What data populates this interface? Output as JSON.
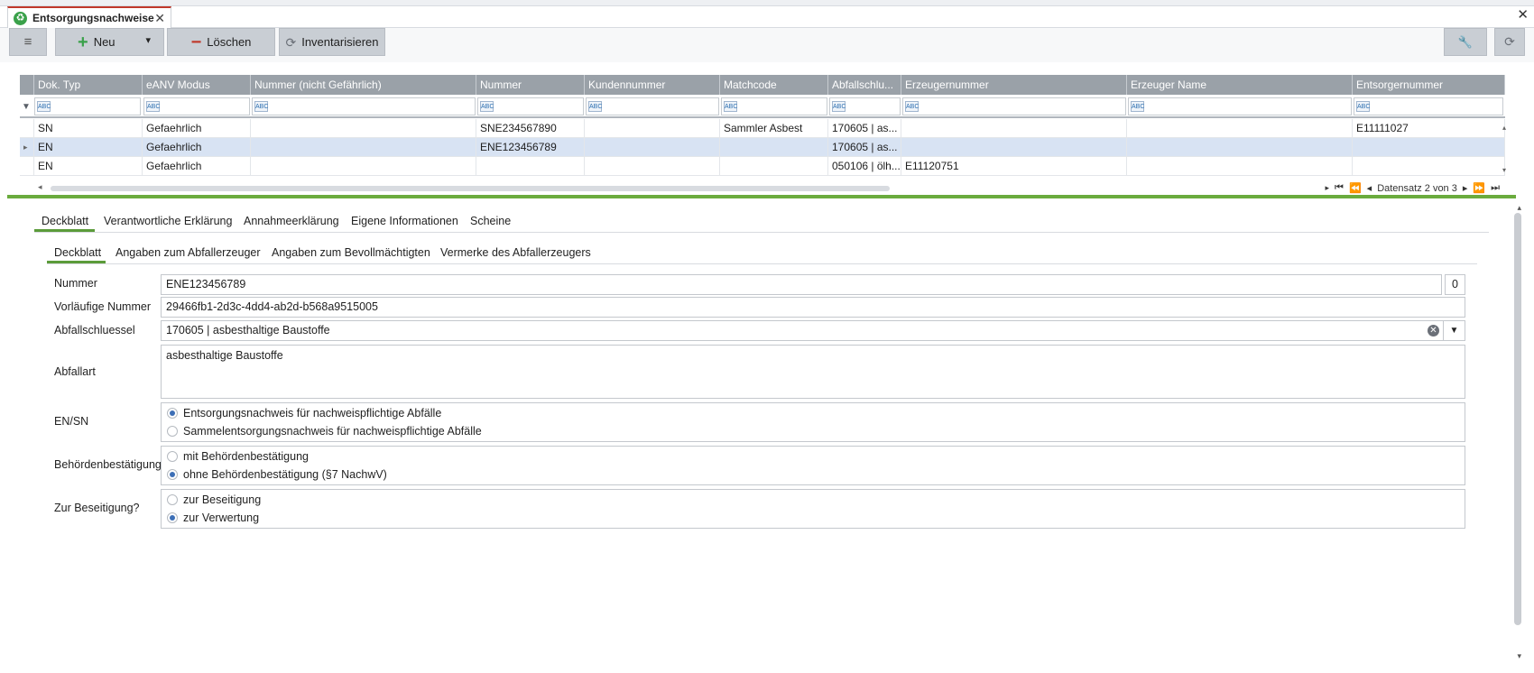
{
  "window": {
    "tab_title": "Entsorgungsnachweise",
    "tab_close": "✕",
    "close": "✕"
  },
  "toolbar": {
    "menu_icon": "hamburger-icon",
    "new_label": "Neu",
    "new_dropdown": "▾",
    "delete_label": "Löschen",
    "inventory_label": "Inventarisieren"
  },
  "grid": {
    "columns": [
      "Dok. Typ",
      "eANV Modus",
      "Nummer (nicht Gefährlich)",
      "Nummer",
      "Kundennummer",
      "Matchcode",
      "Abfallschlu...",
      "Erzeugernummer",
      "Erzeuger Name",
      "Entsorgernummer"
    ],
    "filter_badge": "ABC",
    "rows": [
      {
        "selected": false,
        "indicator": "",
        "cells": [
          "SN",
          "Gefaehrlich",
          "",
          "SNE234567890",
          "",
          "Sammler Asbest",
          "170605 | as...",
          "",
          "",
          "E11111027"
        ]
      },
      {
        "selected": true,
        "indicator": "▸",
        "cells": [
          "EN",
          "Gefaehrlich",
          "",
          "ENE123456789",
          "",
          "",
          "170605 | as...",
          "",
          "",
          ""
        ]
      },
      {
        "selected": false,
        "indicator": "",
        "cells": [
          "EN",
          "Gefaehrlich",
          "",
          "",
          "",
          "",
          "050106 | ölh...",
          "E11120751",
          "",
          ""
        ]
      }
    ],
    "record_label": "Datensatz 2 von 3"
  },
  "tabs_main": [
    "Deckblatt",
    "Verantwortliche Erklärung",
    "Annahmeerklärung",
    "Eigene Informationen",
    "Scheine"
  ],
  "tabs_sub": [
    "Deckblatt",
    "Angaben zum Abfallerzeuger",
    "Angaben zum Bevollmächtigten",
    "Vermerke des Abfallerzeugers"
  ],
  "form": {
    "nummer_label": "Nummer",
    "nummer_value": "ENE123456789",
    "nummer_counter": "0",
    "vorl_label": "Vorläufige Nummer",
    "vorl_value": "29466fb1-2d3c-4dd4-ab2d-b568a9515005",
    "schluessel_label": "Abfallschluessel",
    "schluessel_value": "170605 | asbesthaltige Baustoffe",
    "abfallart_label": "Abfallart",
    "abfallart_value": "asbesthaltige Baustoffe",
    "ensn_label": "EN/SN",
    "ensn_options": [
      "Entsorgungsnachweis für nachweispflichtige Abfälle",
      "Sammelentsorgungsnachweis für nachweispflichtige Abfälle"
    ],
    "ensn_selected": 0,
    "beh_label": "Behördenbestätigung",
    "beh_options": [
      "mit Behördenbestätigung",
      "ohne Behördenbestätigung (§7 NachwV)"
    ],
    "beh_selected": 1,
    "bes_label": "Zur Beseitigung?",
    "bes_options": [
      "zur Beseitigung",
      "zur Verwertung"
    ],
    "bes_selected": 1
  },
  "colors": {
    "accent_green": "#6aab3d",
    "header_gray": "#9aa1a8",
    "selected_row": "#d8e3f3",
    "radio_on": "#3d6fb6"
  }
}
